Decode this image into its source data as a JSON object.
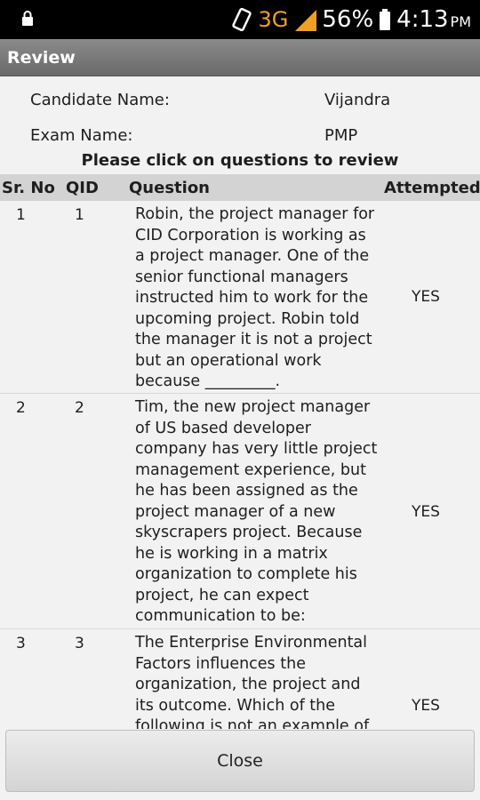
{
  "status_bar": {
    "network": "3G",
    "battery_percent": "56%",
    "time": "4:13",
    "ampm": "PM"
  },
  "title": "Review",
  "candidate": {
    "label": "Candidate Name:",
    "value": "Vijandra"
  },
  "exam": {
    "label": "Exam Name:",
    "value": "PMP"
  },
  "instruction": "Please click on questions to review",
  "table": {
    "headers": {
      "sr_no": "Sr. No",
      "qid": "QID",
      "question": "Question",
      "attempted": "Attempted"
    },
    "rows": [
      {
        "sr_no": "1",
        "qid": "1",
        "question": "Robin, the project manager for CID Corporation is working as a project manager. One of the senior functional managers instructed him to work for the upcoming project. Robin told the manager it is not a project but an operational work because _________.",
        "attempted": "YES"
      },
      {
        "sr_no": "2",
        "qid": "2",
        "question": "Tim, the new project manager of US based developer company has very little project management experience, but he has been assigned as the project manager of a new skyscrapers project. Because he is working in a matrix organization to complete his project, he can expect communication to be:",
        "attempted": "YES"
      },
      {
        "sr_no": "3",
        "qid": "3",
        "question": "The Enterprise Environmental Factors influences the organization, the project and its outcome. Which of the following is not an example of",
        "attempted": "YES"
      }
    ]
  },
  "close_button": "Close",
  "colors": {
    "status_bar": "#000000",
    "network_accent": "#f0a020",
    "title_bar": "#7a7a7a",
    "table_header": "#d3d3d3",
    "background": "#f2f2f2"
  }
}
